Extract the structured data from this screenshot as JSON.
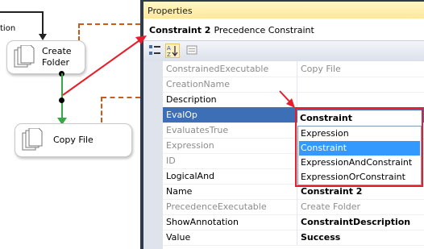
{
  "canvas": {
    "fragment_label": "tion",
    "tasks": [
      {
        "label_line1": "Create",
        "label_line2": "Folder",
        "icon": "file-system-task-icon"
      },
      {
        "label_line1": "Copy File",
        "label_line2": "",
        "icon": "file-system-task-icon"
      }
    ]
  },
  "panel": {
    "title": "Properties",
    "object_name": "Constraint 2",
    "object_type": "Precedence Constraint",
    "toolbar": {
      "categorized_icon": "categorized-icon",
      "alphabetical_icon": "alphabetical-sort-icon",
      "property_pages_icon": "property-pages-icon"
    },
    "rows": [
      {
        "name": "ConstrainedExecutable",
        "value": "Copy File",
        "readonly": true
      },
      {
        "name": "CreationName",
        "value": "",
        "readonly": true
      },
      {
        "name": "Description",
        "value": "",
        "readonly": false
      },
      {
        "name": "EvalOp",
        "value": "Constraint",
        "readonly": false
      },
      {
        "name": "EvaluatesTrue",
        "value": "",
        "readonly": true
      },
      {
        "name": "Expression",
        "value": "",
        "readonly": true
      },
      {
        "name": "ID",
        "value": "",
        "readonly": true
      },
      {
        "name": "LogicalAnd",
        "value": "",
        "readonly": false
      },
      {
        "name": "Name",
        "value": "Constraint 2",
        "readonly": false
      },
      {
        "name": "PrecedenceExecutable",
        "value": "Create Folder",
        "readonly": true
      },
      {
        "name": "ShowAnnotation",
        "value": "ConstraintDescription",
        "readonly": false
      },
      {
        "name": "Value",
        "value": "Success",
        "readonly": false
      }
    ],
    "evalop_options": [
      "Expression",
      "Constraint",
      "ExpressionAndConstraint",
      "ExpressionOrConstraint"
    ],
    "evalop_selected": "Constraint"
  },
  "colors": {
    "annotation_red": "#e41e2a",
    "dashed_orange": "#cc5a1a",
    "success_green": "#3aa64a",
    "selection_blue": "#3c6fb5",
    "dropdown_highlight": "#3399ff"
  }
}
